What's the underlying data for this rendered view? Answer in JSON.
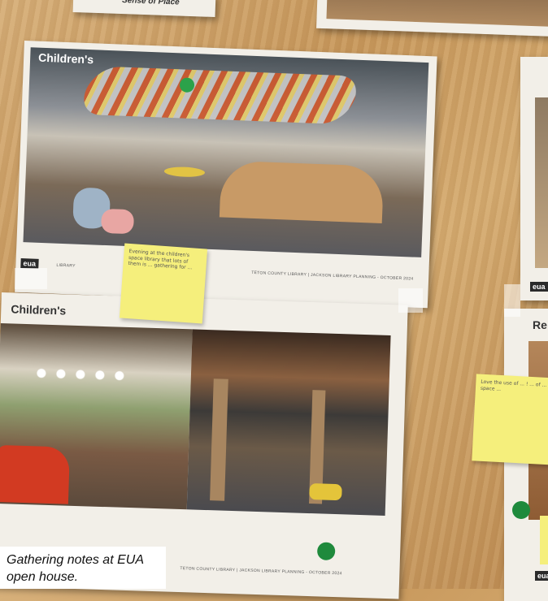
{
  "boards": {
    "top_left_fragment": "Sense of Place",
    "top_board_label": "Children's",
    "bottom_board_label": "Children's",
    "right_board_label": "Re",
    "footer": "TETON COUNTY LIBRARY | JACKSON LIBRARY PLANNING - OCTOBER 2024",
    "logo_eua": "eua",
    "logo_library": "LIBRARY"
  },
  "sticky_notes": {
    "note1": "Evening at the children's space library that lots of them is ... gathering for ... ",
    "note2": "Love the use of ... ! ... of ... space ... "
  },
  "caption": "Gathering notes at EUA open house.",
  "colors": {
    "wood": "#d0a26a",
    "board": "#f2efe8",
    "sticky": "#f5ef7c",
    "dot": "#1f8a3c"
  }
}
